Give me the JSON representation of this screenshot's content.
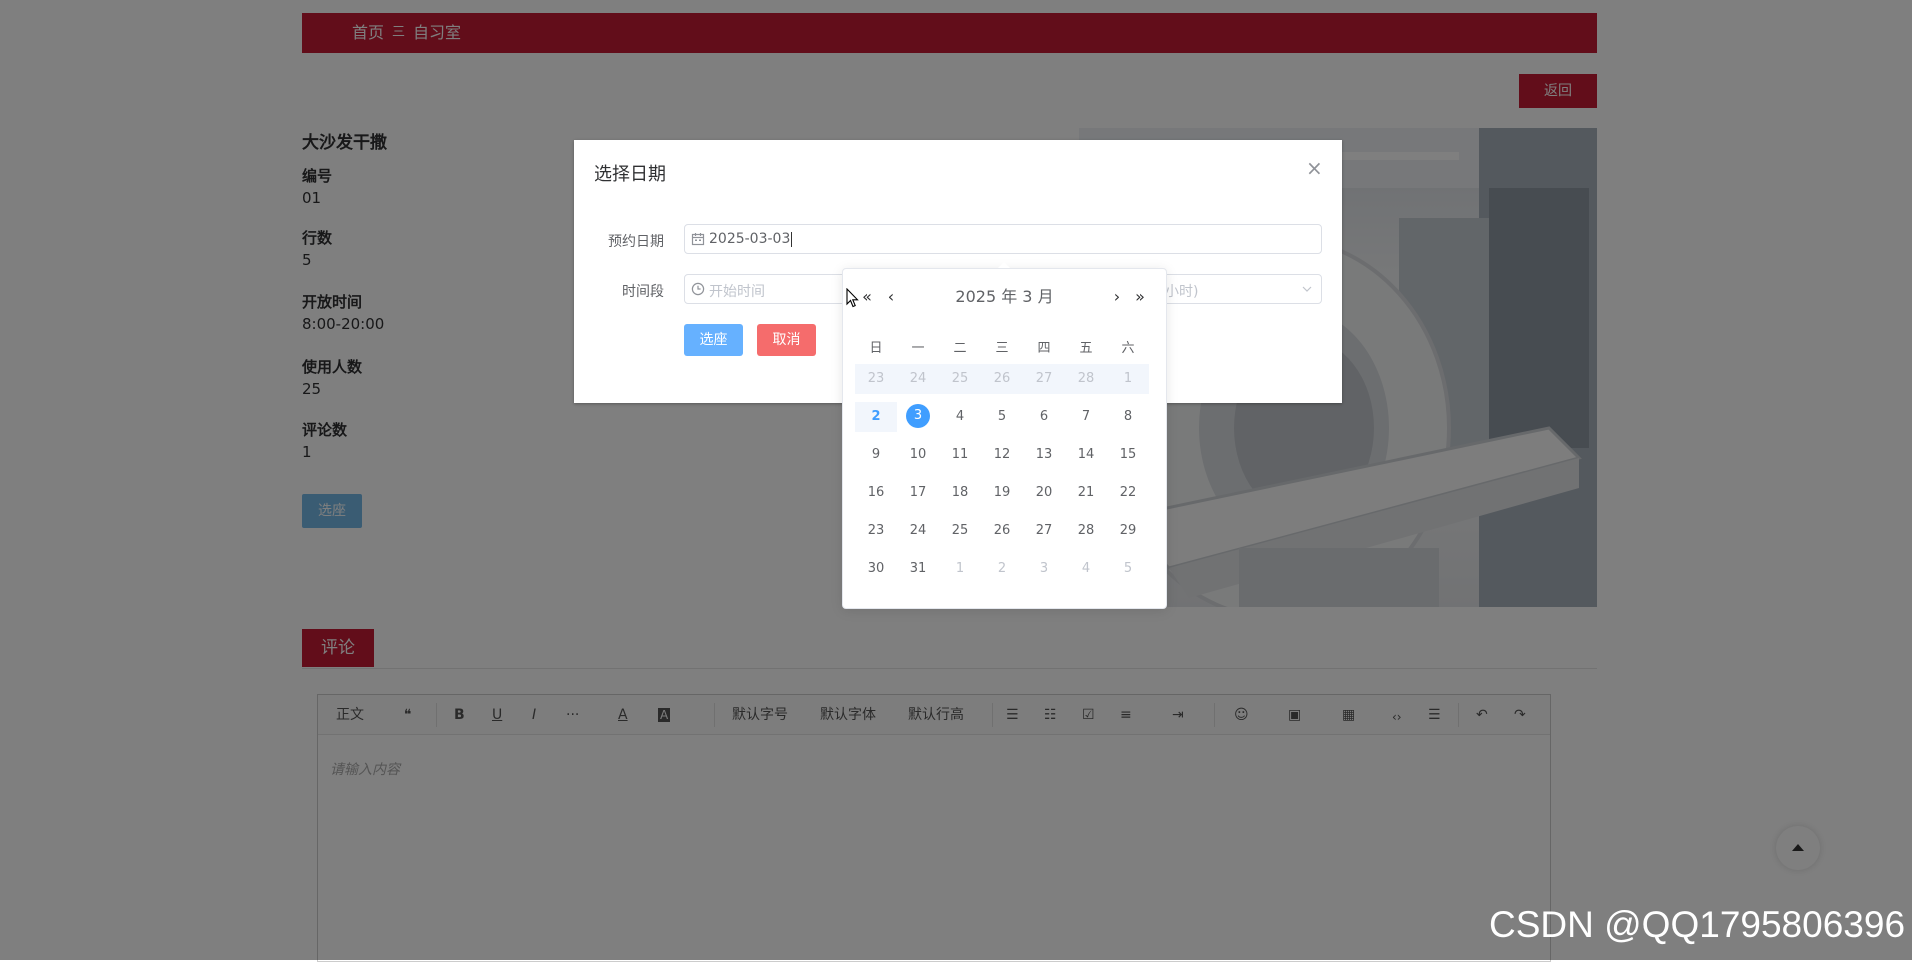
{
  "nav": {
    "home": "首页",
    "separator": "三",
    "current": "自习室"
  },
  "back_label": "返回",
  "room": {
    "title": "大沙发干撒",
    "fields": [
      {
        "label": "编号",
        "value": "01"
      },
      {
        "label": "行数",
        "value": "5"
      },
      {
        "label": "开放时间",
        "value": "8:00-20:00"
      },
      {
        "label": "使用人数",
        "value": "25"
      },
      {
        "label": "评论数",
        "value": "1"
      }
    ],
    "select_seat_label": "选座"
  },
  "comments": {
    "tab_label": "评论",
    "toolbar": [
      "正文",
      "❝",
      "B",
      "U",
      "I",
      "···",
      "A",
      "A",
      "默认字号",
      "默认字体",
      "默认行高",
      "☰",
      "☷",
      "☑",
      "≡",
      "⇥",
      "☺",
      "▣",
      "▦",
      "‹›",
      "☰",
      "↶",
      "↷"
    ],
    "placeholder": "请输入内容"
  },
  "dialog": {
    "title": "选择日期",
    "date_label": "预约日期",
    "date_value": "2025-03-03",
    "time_label": "时间段",
    "time_start_placeholder": "开始时间",
    "time_end_placeholder": "小时)",
    "ok_label": "选座",
    "cancel_label": "取消"
  },
  "picker": {
    "title": "2025 年  3 月",
    "prev_year": "«",
    "prev_month": "‹",
    "next_month": "›",
    "next_year": "»",
    "weekdays": [
      "日",
      "一",
      "二",
      "三",
      "四",
      "五",
      "六"
    ],
    "weeks": [
      [
        "23",
        "24",
        "25",
        "26",
        "27",
        "28",
        "1"
      ],
      [
        "2",
        "3",
        "4",
        "5",
        "6",
        "7",
        "8"
      ],
      [
        "9",
        "10",
        "11",
        "12",
        "13",
        "14",
        "15"
      ],
      [
        "16",
        "17",
        "18",
        "19",
        "20",
        "21",
        "22"
      ],
      [
        "23",
        "24",
        "25",
        "26",
        "27",
        "28",
        "29"
      ],
      [
        "30",
        "31",
        "1",
        "2",
        "3",
        "4",
        "5"
      ]
    ],
    "today": "2",
    "selected": "3",
    "colors": {
      "primary": "#409eff",
      "muted": "#c0c4cc"
    }
  },
  "watermark": "CSDN @QQ1795806396",
  "colors": {
    "brand": "#c41a34",
    "overlay": "rgba(0,0,0,0.5)"
  }
}
